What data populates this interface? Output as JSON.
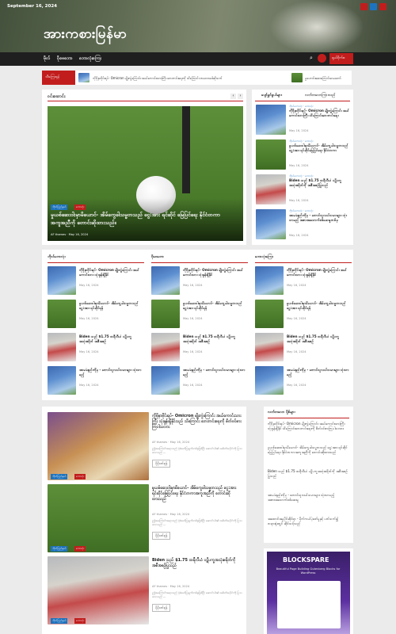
{
  "topbar": {
    "date": "September 16, 2024"
  },
  "site": {
    "title": "အားကစားမြန်မာ"
  },
  "nav": {
    "items": [
      "ဗိုလ်",
      "ဝိုဗေဘော",
      "ဘောလုံးကြေး"
    ],
    "button": "ရှယ်ဝိုက်စ"
  },
  "ticker": {
    "label": "သီကြေးရုန်",
    "items": [
      "ကိုဗိုနာဗိုင်းရပ်- Omicron မျိုးကွဲကြောင်း အယ်ကောင်းသားကြီး ဘေးကင်းရေးကို သိကြောင်း တလောဒေါဆိုသက်",
      "မှုဟောင်းဆေးကြောင်းမာမတော်"
    ]
  },
  "hero": {
    "title": "ဝင်းဆောင်း",
    "slide_title": "မှုယစ်ဆေးဝါးမှာမိယောင်- အိမ်ကွေခါသမ္မတသည် ငွေ:အား ရင်ဆိုင် မြေပြင်ရေး နိုင်ငံတကာအကူအညီကို တောင်းဆိုထားသည်။",
    "badges": [
      "ဘိုလ်ပြည်နယ်",
      "ဘောလုံး"
    ],
    "author": "AF thames",
    "date": "May 16, 2024"
  },
  "sidebar_tabs": [
    "ပျော်ရွှင်ဖွယ်များ",
    "လတ်တလောကြားသည်"
  ],
  "sidebar_list": [
    {
      "cat": "ဘိုလ်ဘောလုံး · ဘောလုံး",
      "title": "ကိုဗိုနာဗိုင်းရပ်- Omicron မျိုးကွဲကြောင်း အယ်ကောင်းသားကြီး သိကြောင်းဘေးကင်းရေး",
      "date": "May 16, 2024"
    },
    {
      "cat": "ဘိုလ်ဘောလုံး · ဘောလုံး",
      "title": "မှုယစ်ဆေးဝါးမှာမိယောင်- အိမ်ကွေခါသမ္မတသည် ငွေ:အား ရင်ဆိုင်မြေပြင်ရေး နိုင်ငံတကာ",
      "date": "May 16, 2024"
    },
    {
      "cat": "ဘိုလ်ဘောလုံး · ဘောလုံး",
      "title": "Biden သည် $1.75 ထရီလီယံ ပဋိပက္ခအသုံးစရိတ်ကို အစီအစဉ်ပြုသည်",
      "date": "May 16, 2024"
    },
    {
      "cat": "ဘိုလ်ဘောလုံး · ဘောလုံး",
      "title": "အာမခံနည်းကိုမှ - တောင်သူလယ်သမားများ သုံးသာမည့် အစားအသောက်စစ်ဆေးမှုတစ်ခု",
      "date": "May 16, 2024"
    }
  ],
  "columns": [
    {
      "title": "ဘိုလ်ဘောလုံး",
      "items": [
        {
          "title": "ကိုဗိုနာဗိုင်းရပ်- Omicron မျိုးကွဲကြောင်း အယ်ကောင်းသား သုံးနှုန်းရှိနိုင်",
          "date": "May 16, 2024"
        },
        {
          "title": "မှုယစ်ဆေးဝါးမှာမိယောင်- အိမ်ကွေခါသမ္မတသည် ငွေ:အား ရင်ဆိုင်ရန်",
          "date": "May 16, 2024"
        },
        {
          "title": "Biden သည် $1.75 ထရီလီယံ ပဋိပက္ခအသုံးစရိတ် အစီအစဉ်",
          "date": "May 16, 2024"
        },
        {
          "title": "အာမခံနည်းကိုမှ - တောင်သူလယ်သမားများ သုံးသာမည့်",
          "date": "May 16, 2024"
        }
      ]
    },
    {
      "title": "ဝိုဗေဘော",
      "items": [
        {
          "title": "ကိုဗိုနာဗိုင်းရပ်- Omicron မျိုးကွဲကြောင်း အယ်ကောင်းသား သုံးနှုန်းရှိနိုင်",
          "date": "May 16, 2024"
        },
        {
          "title": "မှုယစ်ဆေးဝါးမှာမိယောင်- အိမ်ကွေခါသမ္မတသည် ငွေ:အား ရင်ဆိုင်ရန်",
          "date": "May 16, 2024"
        },
        {
          "title": "Biden သည် $1.75 ထရီလီယံ ပဋိပက္ခအသုံးစရိတ် အစီအစဉ်",
          "date": "May 16, 2024"
        },
        {
          "title": "အာမခံနည်းကိုမှ - တောင်သူလယ်သမားများ သုံးသာမည့်",
          "date": "May 16, 2024"
        }
      ]
    },
    {
      "title": "ဘောလုံးကြေး",
      "items": [
        {
          "title": "ကိုဗိုနာဗိုင်းရပ်- Omicron မျိုးကွဲကြောင်း အယ်ကောင်းသား သုံးနှုန်းရှိနိုင်",
          "date": "May 16, 2024"
        },
        {
          "title": "မှုယစ်ဆေးဝါးမှာမိယောင်- အိမ်ကွေခါသမ္မတသည် ငွေ:အား ရင်ဆိုင်ရန်",
          "date": "May 16, 2024"
        },
        {
          "title": "Biden သည် $1.75 ထရီလီယံ ပဋိပက္ခအသုံးစရိတ် အစီအစဉ်",
          "date": "May 16, 2024"
        },
        {
          "title": "အာမခံနည်းကိုမှ - တောင်သူလယ်သမားများ သုံးသာမည့်",
          "date": "May 16, 2024"
        }
      ]
    }
  ],
  "posts": [
    {
      "title": "ကိုဗိုနာဗိုင်းရပ်- Omicron မျိုးကွဲကြောင်း အယ်ကောင်းသားကြီး သုံးနှုန်းရှိနိုင်သည် သိကြောင်း ဘေးကင်းရေးကို စိတ်ဝင်စားကြပါသလား",
      "author": "AF thames",
      "date": "May 16, 2024",
      "snippet": "ဤအကြောင်းအရာသည် ပုံစံဖော်ပြချက်တစ်ခုဖြစ်ပြီး ဆောင်းပါး၏ အစိတ်အပိုင်းကို ပြသထားသည် ...",
      "more": "ပိုမိုဖတ်ရန်"
    },
    {
      "title": "မှုယစ်ဆေးဝါးမှာမိယောင်- အိမ်ကွေခါသမ္မတသည် ငွေ:အား ရင်ဆိုင်မြေပြင်ရေး နိုင်ငံတကာအကူအညီကို တောင်းဆိုထားသည်",
      "author": "AF thames",
      "date": "May 16, 2024",
      "snippet": "ဤအကြောင်းအရာသည် ပုံစံဖော်ပြချက်တစ်ခုဖြစ်ပြီး ဆောင်းပါး၏ အစိတ်အပိုင်းကို ပြသထားသည် ...",
      "more": "ပိုမိုဖတ်ရန်"
    },
    {
      "title": "Biden သည် $1.75 ထရီလီယံ ပဋိပက္ခအသုံးစရိတ်ကို အစီအစဉ်ပြုသည်",
      "author": "AF thames",
      "date": "May 16, 2024",
      "snippet": "ဤအကြောင်းအရာသည် ပုံစံဖော်ပြချက်တစ်ခုဖြစ်ပြီး ဆောင်းပါး၏ အစိတ်အပိုင်းကို ပြသထားသည် ...",
      "more": "ပိုမိုဖတ်ရန်"
    }
  ],
  "post_badges": [
    "ဘိုလ်ပြည်နယ်",
    "ဘောလုံး"
  ],
  "recent": {
    "title": "လတ်တလော ပို့စ်များ",
    "items": [
      "ကိုဗိုနာဗိုင်းရပ်- Omicron မျိုးကွဲကြောင်း အယ်ကောင်းသားကြီး သုံးနှုန်းရှိနိုင် သိကြောင်းဘေးကင်းရေးကို စိတ်ဝင်စားကြပါသလား",
      "မှုယစ်ဆေးဝါးမှာမိယောင်- အိမ်ကွေခါသမ္မတသည် ငွေ:အား ရင်ဆိုင်မြေပြင်ရေး နိုင်ငံတကာအကူအညီကို တောင်းဆိုထားသည်",
      "Biden သည် $1.75 ထရီလီယံ ပဋိပက္ခအသုံးစရိတ်ကို အစီအစဉ်ပြုသည်",
      "အာမခံနည်းကိုမှ - တောင်သူလယ်သမားများ သုံးသာမည့် အစားအသောက်စစ်ဆေးမှု",
      "အထောင်အမှုပိုင်ဆိုင်ရာ - မိုက်ကယ်ပဲ့ဖော်မှုနှင့် ပတ်သက်၍ တရားရုံးတွင် ဆိုင်သင့်သည်"
    ]
  },
  "ad": {
    "brand": "BLOCKSPARE",
    "tagline": "Beautiful Page Building Gutenberg Blocks for WordPress"
  }
}
